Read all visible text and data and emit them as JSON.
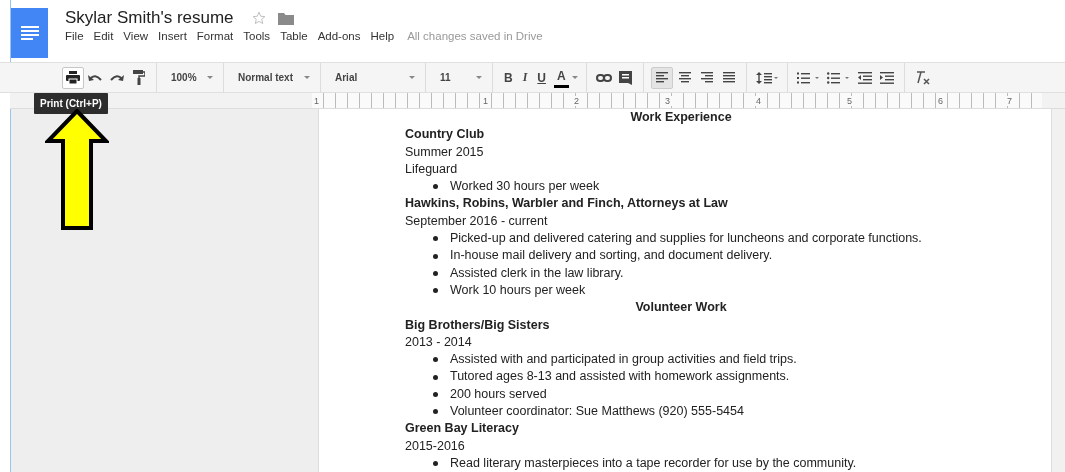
{
  "app": {
    "title": "Skylar Smith's resume",
    "starred": false,
    "menu": [
      "File",
      "Edit",
      "View",
      "Insert",
      "Format",
      "Tools",
      "Table",
      "Add-ons",
      "Help"
    ],
    "save_status": "All changes saved in Drive"
  },
  "toolbar": {
    "print_hovered": true,
    "zoom": "100%",
    "style": "Normal text",
    "font": "Arial",
    "size": "11",
    "text_styles": [
      {
        "kind": "bold",
        "label": "B"
      },
      {
        "kind": "italic",
        "label": "I"
      },
      {
        "kind": "underline",
        "label": "U"
      },
      {
        "kind": "color",
        "label": "A"
      }
    ],
    "alignments": [
      {
        "kind": "left",
        "selected": true
      },
      {
        "kind": "center",
        "selected": false
      },
      {
        "kind": "right",
        "selected": false
      },
      {
        "kind": "justify",
        "selected": false
      }
    ]
  },
  "tooltip": "Print (Ctrl+P)",
  "ruler": [
    "1",
    "1",
    "2",
    "3",
    "4",
    "5",
    "6",
    "7"
  ],
  "document": [
    {
      "kind": "heading",
      "text": "Work Experience"
    },
    {
      "kind": "bold",
      "text": "Country Club"
    },
    {
      "kind": "plain",
      "text": "Summer 2015"
    },
    {
      "kind": "plain",
      "text": "Lifeguard"
    },
    {
      "kind": "bullet",
      "text": "Worked 30 hours per week"
    },
    {
      "kind": "bold",
      "text": "Hawkins, Robins, Warbler and Finch, Attorneys at Law"
    },
    {
      "kind": "plain",
      "text": "September 2016 - current"
    },
    {
      "kind": "bullet",
      "text": "Picked-up and delivered catering and supplies for luncheons and corporate functions."
    },
    {
      "kind": "bullet",
      "text": "In-house mail delivery and sorting, and document delivery."
    },
    {
      "kind": "bullet",
      "text": "Assisted clerk in the law library."
    },
    {
      "kind": "bullet",
      "text": "Work 10 hours per week"
    },
    {
      "kind": "heading",
      "text": "Volunteer Work"
    },
    {
      "kind": "bold",
      "text": "Big Brothers/Big Sisters"
    },
    {
      "kind": "plain",
      "text": "2013 - 2014"
    },
    {
      "kind": "bullet",
      "text": "Assisted with and participated in group activities and field trips."
    },
    {
      "kind": "bullet",
      "text": "Tutored ages 8-13 and assisted with homework assignments."
    },
    {
      "kind": "bullet",
      "text": "200 hours served"
    },
    {
      "kind": "bullet",
      "text": "Volunteer coordinator: Sue Matthews (920) 555-5454"
    },
    {
      "kind": "bold",
      "text": "Green Bay Literacy"
    },
    {
      "kind": "plain",
      "text": "2015-2016"
    },
    {
      "kind": "bullet",
      "text": "Read literary masterpieces into a tape recorder for use by the community."
    }
  ]
}
